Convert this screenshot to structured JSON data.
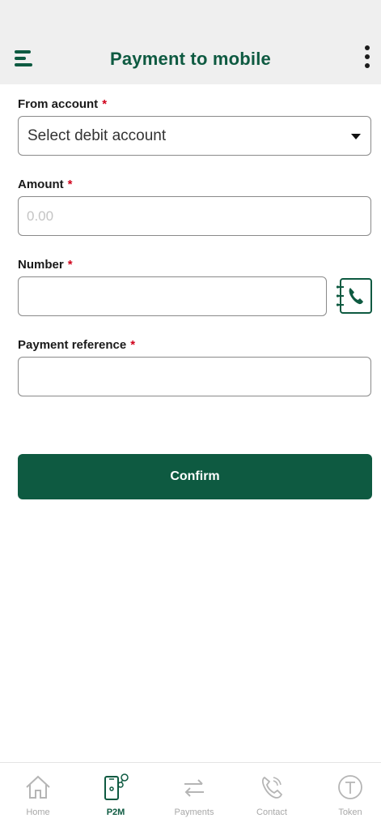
{
  "header": {
    "title": "Payment to mobile",
    "menu_icon": "menu-icon",
    "more_icon": "more-vertical-icon"
  },
  "form": {
    "from_account": {
      "label": "From account",
      "required_mark": "*",
      "value": "Select debit account"
    },
    "amount": {
      "label": "Amount",
      "required_mark": "*",
      "placeholder": "0.00",
      "value": ""
    },
    "number": {
      "label": "Number",
      "required_mark": "*",
      "placeholder": "",
      "value": "",
      "contact_icon": "contact-book-phone-icon"
    },
    "payment_reference": {
      "label": "Payment reference",
      "required_mark": "*",
      "placeholder": "",
      "value": ""
    },
    "confirm_label": "Confirm"
  },
  "bottom_nav": {
    "items": [
      {
        "label": "Home",
        "icon": "home-icon",
        "active": false
      },
      {
        "label": "P2M",
        "icon": "mobile-transfer-icon",
        "active": true
      },
      {
        "label": "Payments",
        "icon": "transfer-arrows-icon",
        "active": false
      },
      {
        "label": "Contact",
        "icon": "phone-call-icon",
        "active": false
      },
      {
        "label": "Token",
        "icon": "token-icon",
        "active": false
      }
    ]
  },
  "colors": {
    "brand": "#0e5a41",
    "required": "#d0021b",
    "header_bg": "#efefef",
    "nav_inactive": "#a8a8a8"
  }
}
